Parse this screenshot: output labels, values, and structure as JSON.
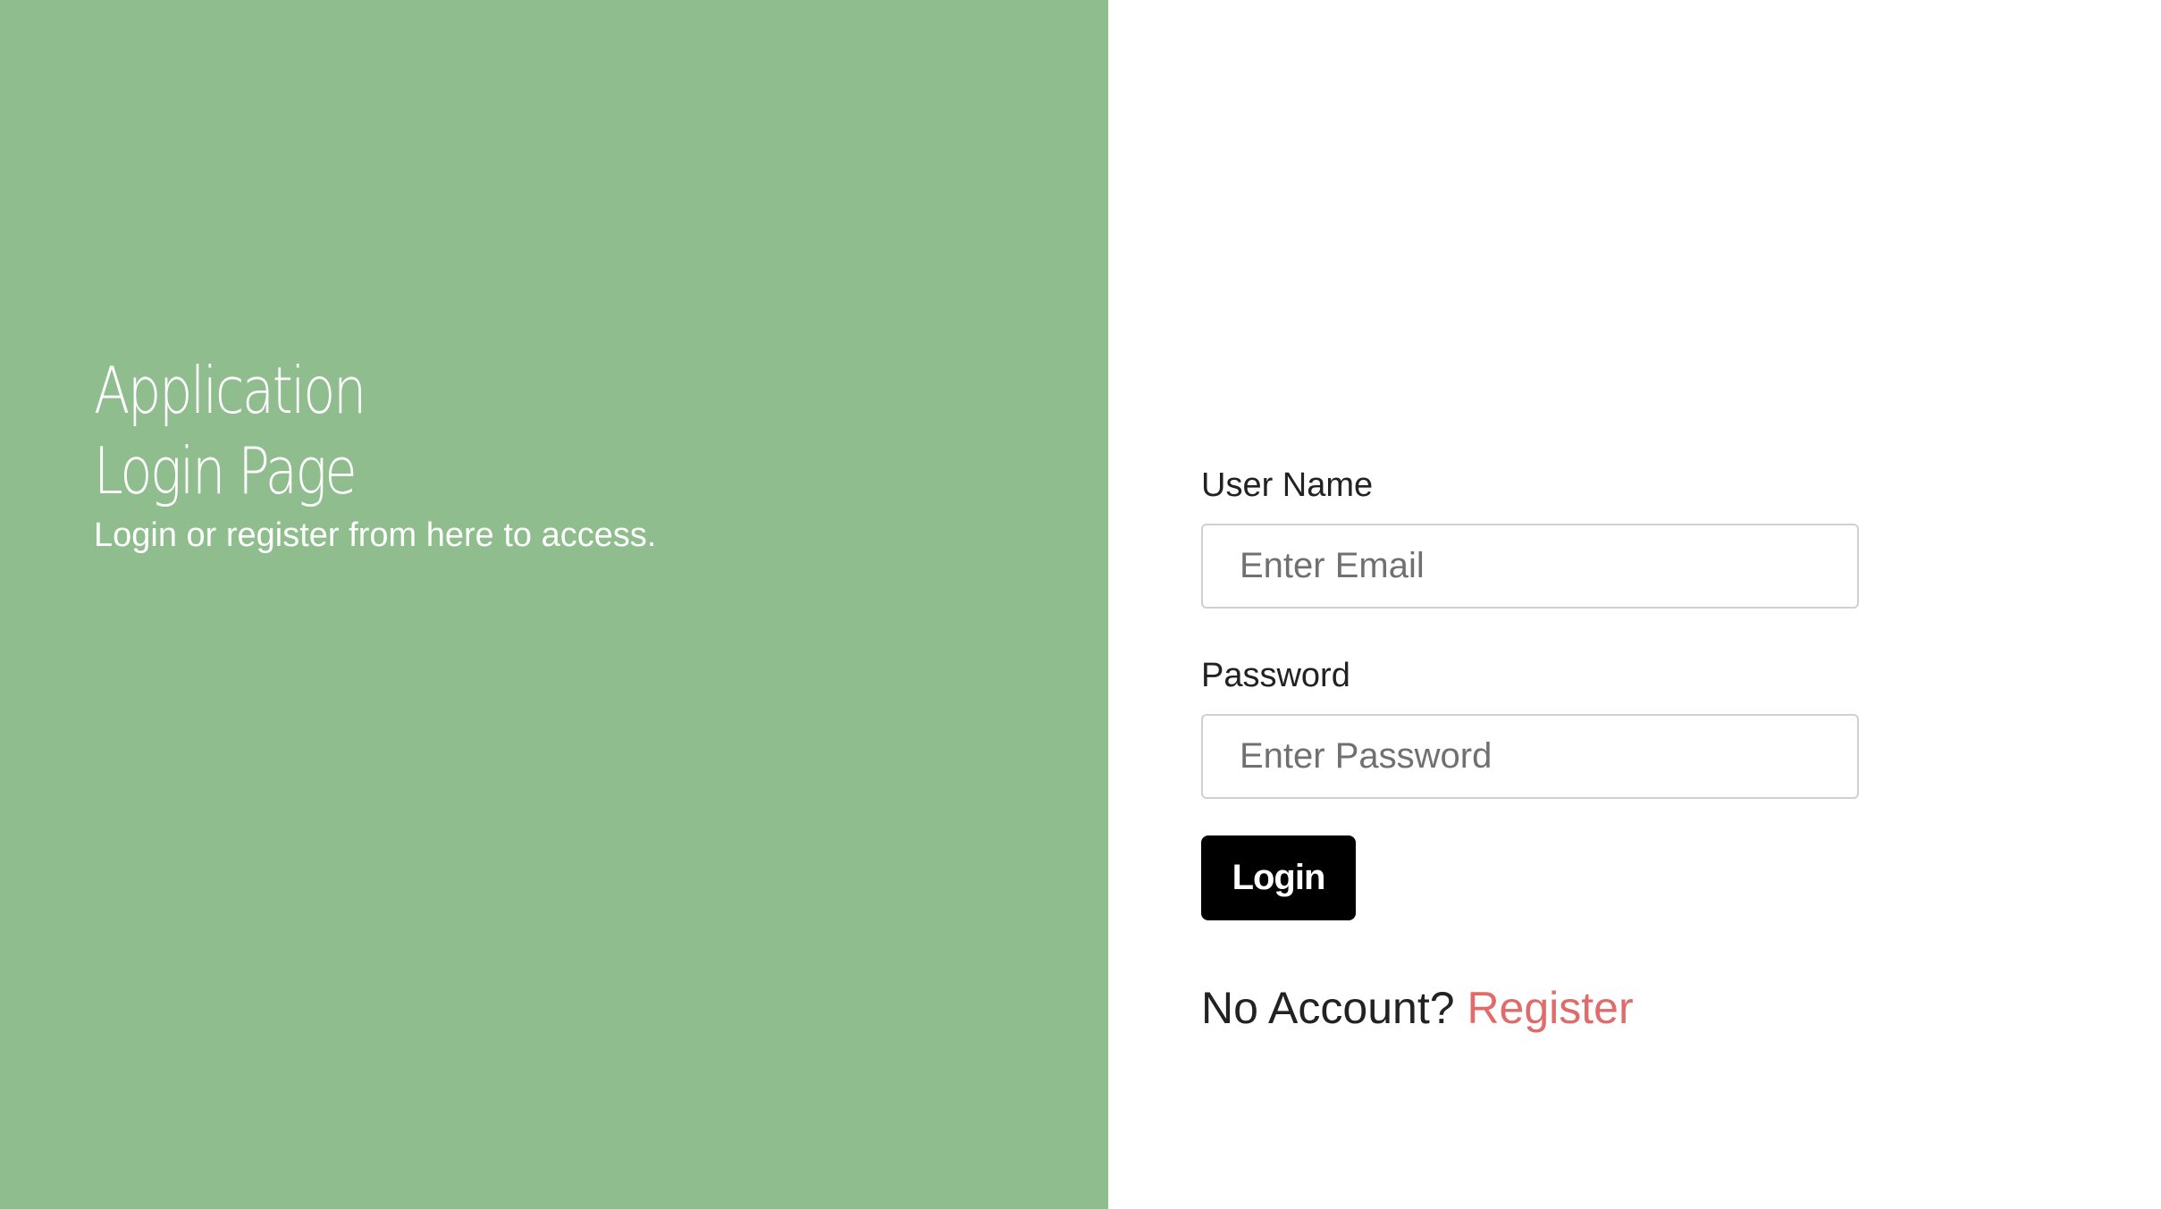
{
  "brand": {
    "title_line1": "Application",
    "title_line2": "Login Page",
    "subtitle": "Login or register from here to access."
  },
  "form": {
    "username_label": "User Name",
    "username_placeholder": "Enter Email",
    "username_value": "",
    "password_label": "Password",
    "password_placeholder": "Enter Password",
    "password_value": "",
    "login_button_label": "Login",
    "no_account_text": "No Account?",
    "register_link_text": "Register"
  },
  "colors": {
    "left_panel_bg": "#8fbd8e",
    "button_bg": "#000000",
    "register_link": "#df6b6b"
  }
}
